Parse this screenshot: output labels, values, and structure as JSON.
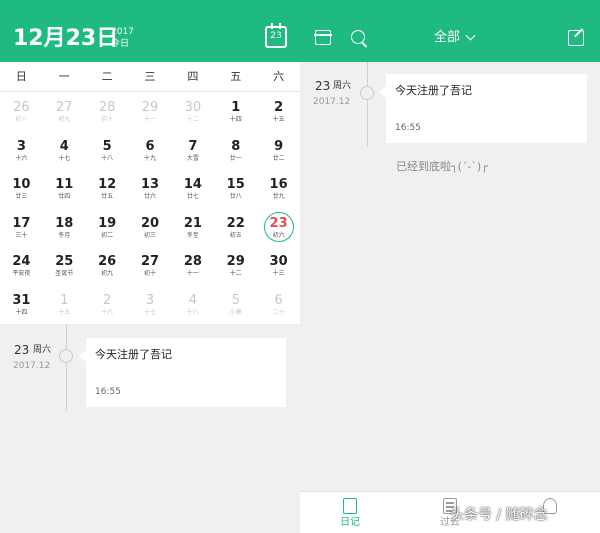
{
  "left_header": {
    "date": "12月23日",
    "year": "2017",
    "today_label": "今日",
    "today_button": "23"
  },
  "calendar": {
    "weekdays": [
      "日",
      "一",
      "二",
      "三",
      "四",
      "五",
      "六"
    ],
    "weeks": [
      [
        {
          "d": "26",
          "l": "初八",
          "dim": true
        },
        {
          "d": "27",
          "l": "初九",
          "dim": true
        },
        {
          "d": "28",
          "l": "初十",
          "dim": true
        },
        {
          "d": "29",
          "l": "十一",
          "dim": true
        },
        {
          "d": "30",
          "l": "十二",
          "dim": true
        },
        {
          "d": "1",
          "l": "十四"
        },
        {
          "d": "2",
          "l": "十五"
        }
      ],
      [
        {
          "d": "3",
          "l": "十六"
        },
        {
          "d": "4",
          "l": "十七"
        },
        {
          "d": "5",
          "l": "十八"
        },
        {
          "d": "6",
          "l": "十九"
        },
        {
          "d": "7",
          "l": "大雪"
        },
        {
          "d": "8",
          "l": "廿一"
        },
        {
          "d": "9",
          "l": "廿二"
        }
      ],
      [
        {
          "d": "10",
          "l": "廿三"
        },
        {
          "d": "11",
          "l": "廿四"
        },
        {
          "d": "12",
          "l": "廿五"
        },
        {
          "d": "13",
          "l": "廿六"
        },
        {
          "d": "14",
          "l": "廿七"
        },
        {
          "d": "15",
          "l": "廿八"
        },
        {
          "d": "16",
          "l": "廿九"
        }
      ],
      [
        {
          "d": "17",
          "l": "三十"
        },
        {
          "d": "18",
          "l": "冬月"
        },
        {
          "d": "19",
          "l": "初二"
        },
        {
          "d": "20",
          "l": "初三"
        },
        {
          "d": "21",
          "l": "冬至"
        },
        {
          "d": "22",
          "l": "初五"
        },
        {
          "d": "23",
          "l": "初六",
          "sel": true
        }
      ],
      [
        {
          "d": "24",
          "l": "平安夜"
        },
        {
          "d": "25",
          "l": "圣诞节"
        },
        {
          "d": "26",
          "l": "初九"
        },
        {
          "d": "27",
          "l": "初十"
        },
        {
          "d": "28",
          "l": "十一"
        },
        {
          "d": "29",
          "l": "十二"
        },
        {
          "d": "30",
          "l": "十三"
        }
      ],
      [
        {
          "d": "31",
          "l": "十四"
        },
        {
          "d": "1",
          "l": "十五",
          "dim": true
        },
        {
          "d": "2",
          "l": "十六",
          "dim": true
        },
        {
          "d": "3",
          "l": "十七",
          "dim": true
        },
        {
          "d": "4",
          "l": "十八",
          "dim": true
        },
        {
          "d": "5",
          "l": "小寒",
          "dim": true
        },
        {
          "d": "6",
          "l": "二十",
          "dim": true
        }
      ]
    ]
  },
  "entry": {
    "day": "23",
    "weekday": "周六",
    "year_month": "2017.12",
    "title": "今天注册了吾记",
    "time": "16:55"
  },
  "right_header": {
    "filter_label": "全部"
  },
  "end_text": "已经到底啦┐(´-`)┌",
  "bottom_nav": {
    "items": [
      {
        "label": "日记",
        "active": true
      },
      {
        "label": "过去"
      },
      {
        "label": ""
      }
    ]
  },
  "watermark": "头条号 / 随碎念"
}
